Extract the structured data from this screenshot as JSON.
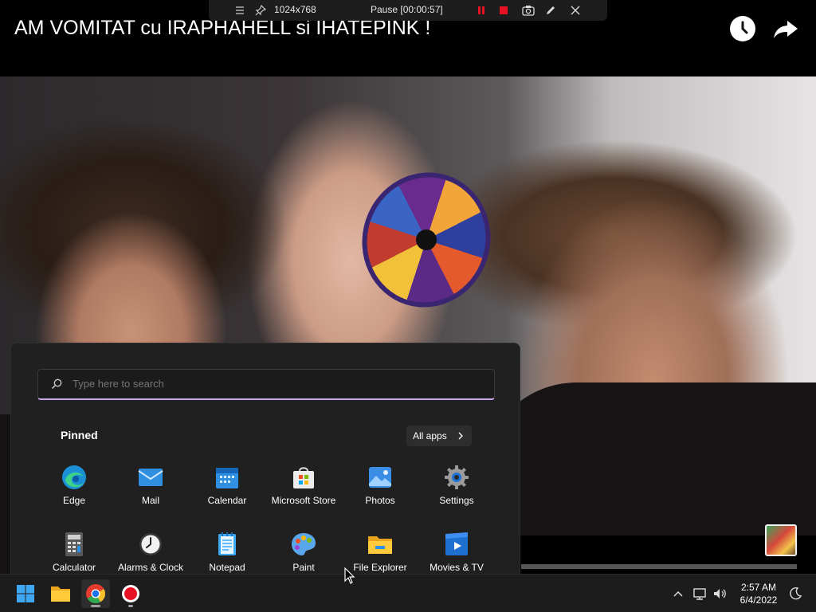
{
  "video": {
    "title": "AM VOMITAT cu IRAPHAHELL si IHATEPINK !"
  },
  "recorder": {
    "resolution": "1024x768",
    "status": "Pause [00:00:57]"
  },
  "start_menu": {
    "search_placeholder": "Type here to search",
    "pinned_label": "Pinned",
    "all_apps_label": "All apps",
    "apps": [
      {
        "label": "Edge",
        "icon": "edge-icon"
      },
      {
        "label": "Mail",
        "icon": "mail-icon"
      },
      {
        "label": "Calendar",
        "icon": "calendar-icon"
      },
      {
        "label": "Microsoft Store",
        "icon": "store-icon"
      },
      {
        "label": "Photos",
        "icon": "photos-icon"
      },
      {
        "label": "Settings",
        "icon": "gear-icon"
      },
      {
        "label": "Calculator",
        "icon": "calculator-icon"
      },
      {
        "label": "Alarms & Clock",
        "icon": "clock-icon"
      },
      {
        "label": "Notepad",
        "icon": "notepad-icon"
      },
      {
        "label": "Paint",
        "icon": "paint-icon"
      },
      {
        "label": "File Explorer",
        "icon": "folder-icon"
      },
      {
        "label": "Movies & TV",
        "icon": "movies-icon"
      }
    ]
  },
  "taskbar": {
    "items": [
      "windows-start-icon",
      "file-explorer-icon",
      "chrome-icon",
      "record-icon"
    ],
    "time": "2:57 AM",
    "date": "6/4/2022"
  },
  "colors": {
    "menu_bg": "#202020",
    "taskbar_bg": "#1c1c1c",
    "search_accent": "#c9a8ea",
    "record_red": "#e81123"
  }
}
